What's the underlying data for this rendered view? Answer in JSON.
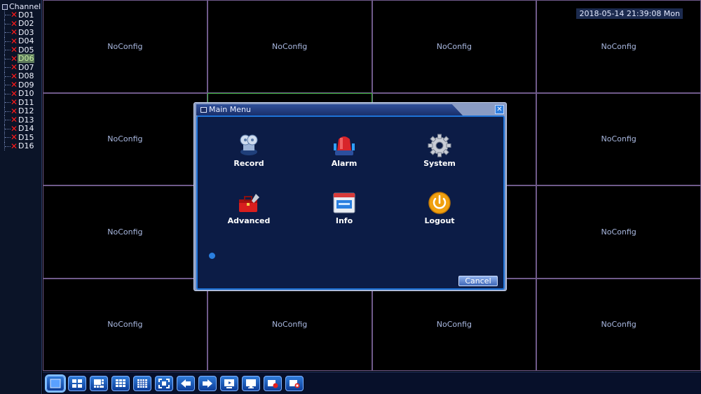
{
  "sidebar": {
    "title": "Channel",
    "channels": [
      "D01",
      "D02",
      "D03",
      "D04",
      "D05",
      "D06",
      "D07",
      "D08",
      "D09",
      "D10",
      "D11",
      "D12",
      "D13",
      "D14",
      "D15",
      "D16"
    ],
    "selected_index": 5
  },
  "datetime": "2018-05-14 21:39:08 Mon",
  "grid": {
    "cells": [
      "NoConfig",
      "NoConfig",
      "NoConfig",
      "NoConfig",
      "NoConfig",
      "",
      "",
      "NoConfig",
      "NoConfig",
      "",
      "",
      "NoConfig",
      "NoConfig",
      "NoConfig",
      "NoConfig",
      "NoConfig"
    ]
  },
  "menu": {
    "title": "Main Menu",
    "items": [
      {
        "label": "Record",
        "icon": "record-icon"
      },
      {
        "label": "Alarm",
        "icon": "alarm-icon"
      },
      {
        "label": "System",
        "icon": "gear-icon"
      },
      {
        "label": "Advanced",
        "icon": "toolbox-icon"
      },
      {
        "label": "Info",
        "icon": "info-icon"
      },
      {
        "label": "Logout",
        "icon": "power-icon"
      }
    ],
    "cancel_label": "Cancel"
  },
  "colors": {
    "accent": "#1e73d8",
    "background": "#000000",
    "grid_line": "#6f5a8a",
    "focus": "#3bb43b",
    "error_mark": "#ff1a1a"
  }
}
